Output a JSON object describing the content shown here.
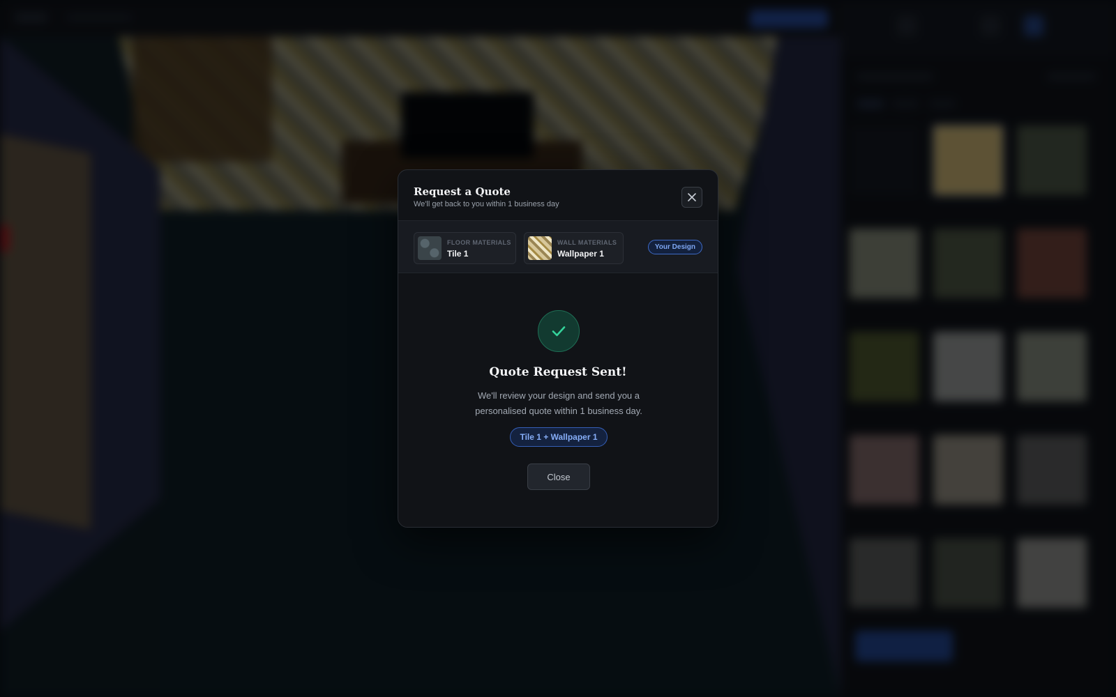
{
  "modal": {
    "title": "Request a Quote",
    "subtitle": "We'll get back to you within 1 business day",
    "close_icon": "close-icon",
    "floor": {
      "label": "FLOOR MATERIALS",
      "name": "Tile 1"
    },
    "wall": {
      "label": "WALL MATERIALS",
      "name": "Wallpaper 1"
    },
    "badge": "Your Design",
    "success": {
      "icon": "check-icon",
      "title": "Quote Request Sent!",
      "message_line1": "We'll review your design and send you a",
      "message_line2": "personalised quote within 1 business day.",
      "summary": "Tile 1 + Wallpaper 1"
    },
    "close_label": "Close"
  },
  "colors": {
    "accent": "#3e6bc8",
    "success": "#34d39b",
    "surface": "#111317"
  }
}
